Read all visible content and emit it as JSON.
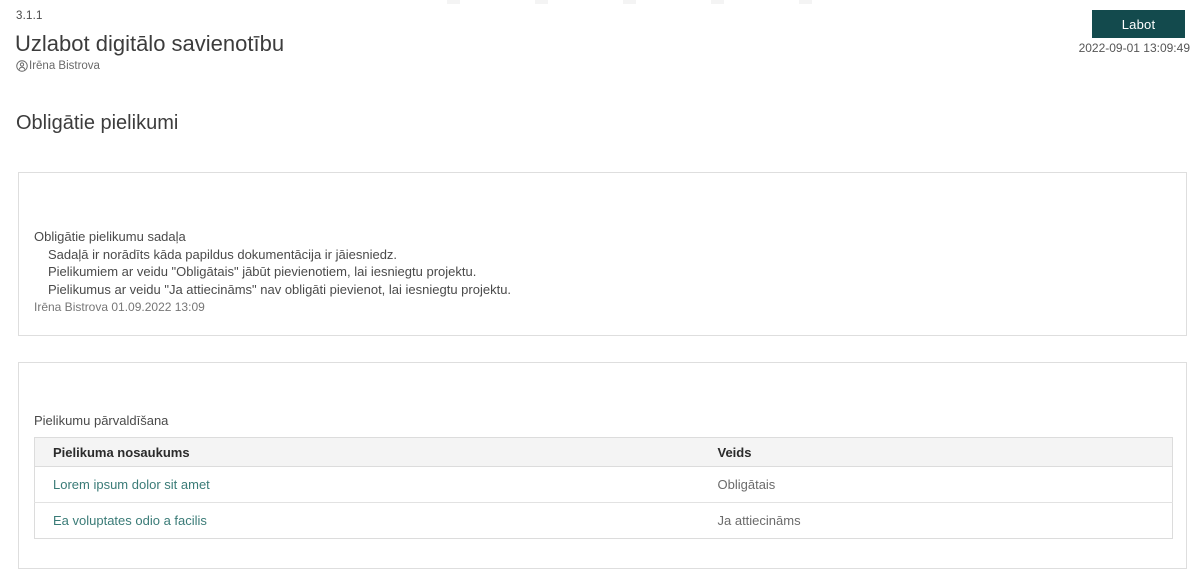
{
  "page": {
    "section_number": "3.1.1",
    "title": "Uzlabot digitālo savienotību",
    "author": "Irēna Bistrova",
    "edit_button_label": "Labot",
    "timestamp": "2022-09-01 13:09:49",
    "section_heading": "Obligātie pielikumi"
  },
  "info_box": {
    "label": "Obligātie pielikumu sadaļa",
    "lines": [
      "Sadaļā ir norādīts kāda papildus dokumentācija ir jāiesniedz.",
      "Pielikumiem ar veidu \"Obligātais\" jābūt pievienotiem, lai iesniegtu projektu.",
      "Pielikumus ar veidu \"Ja attiecināms\" nav obligāti pievienot, lai iesniegtu projektu."
    ],
    "author_line": "Irēna Bistrova 01.09.2022 13:09"
  },
  "attachments": {
    "label": "Pielikumu pārvaldīšana",
    "table": {
      "headers": [
        "Pielikuma nosaukums",
        "Veids"
      ],
      "rows": [
        {
          "name": "Lorem ipsum dolor sit amet",
          "type": "Obligātais"
        },
        {
          "name": "Ea voluptates odio a facilis",
          "type": "Ja attiecināms"
        }
      ]
    }
  },
  "colors": {
    "accent_button": "#134a4d",
    "link_teal": "#3a7b77",
    "table_header_bg": "#f4f4f4",
    "border": "#dedede"
  }
}
